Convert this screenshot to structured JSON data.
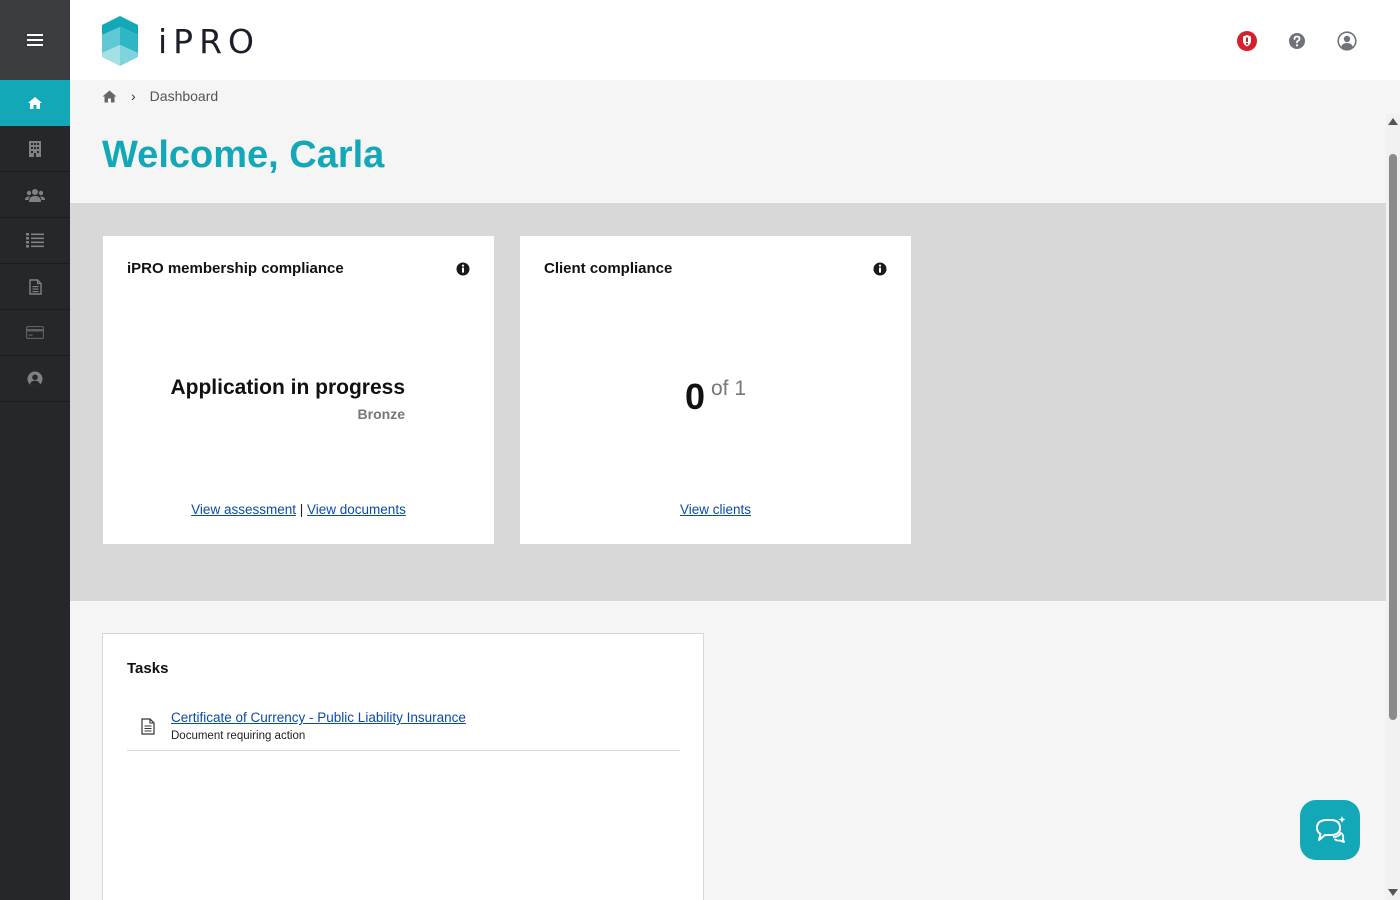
{
  "app": {
    "name": "iPRO"
  },
  "colors": {
    "accent": "#13a8b8",
    "sidebar_bg": "#25272a",
    "link": "#0b4aa8",
    "alert_badge": "#d61f2c"
  },
  "sidebar": {
    "items": [
      {
        "icon": "menu-icon"
      },
      {
        "icon": "home-icon",
        "active": true
      },
      {
        "icon": "building-icon"
      },
      {
        "icon": "users-icon"
      },
      {
        "icon": "list-icon"
      },
      {
        "icon": "document-icon"
      },
      {
        "icon": "credit-card-icon"
      },
      {
        "icon": "user-circle-icon"
      }
    ]
  },
  "header": {
    "icons": [
      "alert-shield-icon",
      "help-icon",
      "account-icon"
    ]
  },
  "breadcrumb": {
    "sep": "›",
    "current": "Dashboard"
  },
  "page": {
    "title": "Welcome, Carla"
  },
  "cards": {
    "membership": {
      "title": "iPRO membership compliance",
      "status": "Application in progress",
      "level": "Bronze",
      "link_assessment": "View assessment",
      "divider": "|",
      "link_documents": "View documents"
    },
    "client": {
      "title": "Client compliance",
      "count": "0",
      "of_text": "of 1",
      "link_clients": "View clients"
    }
  },
  "tasks": {
    "title": "Tasks",
    "items": [
      {
        "title": "Certificate of Currency - Public Liability Insurance",
        "subtitle": "Document requiring action"
      }
    ]
  }
}
